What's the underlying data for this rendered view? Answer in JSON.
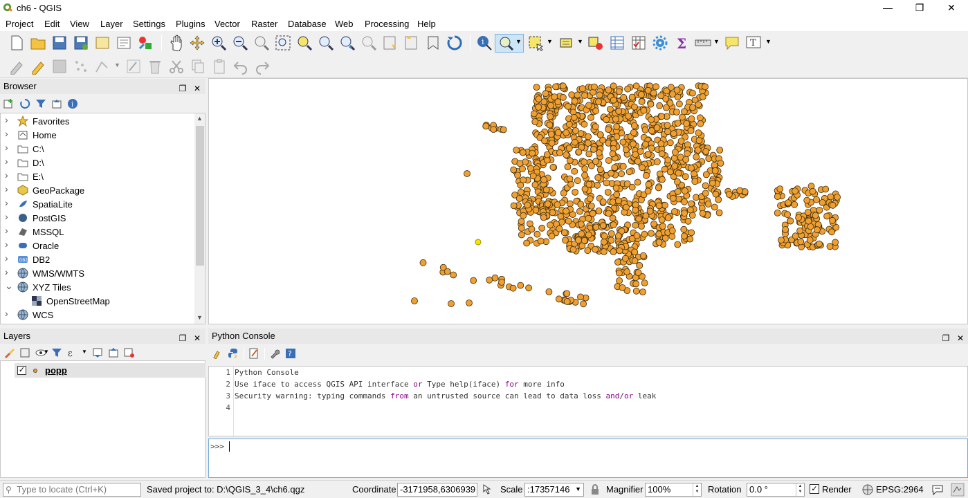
{
  "window": {
    "title": "ch6 - QGIS",
    "minimize": "—",
    "maximize": "❐",
    "close": "✕"
  },
  "menu": [
    "Project",
    "Edit",
    "View",
    "Layer",
    "Settings",
    "Plugins",
    "Vector",
    "Raster",
    "Database",
    "Web",
    "Processing",
    "Help"
  ],
  "browser": {
    "title": "Browser",
    "items": [
      {
        "label": "Favorites",
        "icon": "star-icon",
        "expand": false
      },
      {
        "label": "Home",
        "icon": "home-icon",
        "expand": true
      },
      {
        "label": "C:\\",
        "icon": "folder-icon",
        "expand": true
      },
      {
        "label": "D:\\",
        "icon": "folder-icon",
        "expand": true
      },
      {
        "label": "E:\\",
        "icon": "folder-icon",
        "expand": true
      },
      {
        "label": "GeoPackage",
        "icon": "geopackage-icon",
        "expand": true
      },
      {
        "label": "SpatiaLite",
        "icon": "spatialite-icon",
        "expand": false
      },
      {
        "label": "PostGIS",
        "icon": "postgis-icon",
        "expand": true
      },
      {
        "label": "MSSQL",
        "icon": "mssql-icon",
        "expand": true
      },
      {
        "label": "Oracle",
        "icon": "oracle-icon",
        "expand": true
      },
      {
        "label": "DB2",
        "icon": "db2-icon",
        "expand": true
      },
      {
        "label": "WMS/WMTS",
        "icon": "globe-icon",
        "expand": true
      },
      {
        "label": "XYZ Tiles",
        "icon": "globe-icon",
        "expand": "open"
      },
      {
        "label": "OpenStreetMap",
        "icon": "tiles-icon",
        "expand": "child"
      },
      {
        "label": "WCS",
        "icon": "globe-icon",
        "expand": false
      }
    ]
  },
  "layers": {
    "title": "Layers",
    "items": [
      {
        "label": "popp",
        "checked": true,
        "color": "#e8a040"
      }
    ]
  },
  "console": {
    "title": "Python Console",
    "lines": [
      {
        "no": "1",
        "text": "Python Console"
      },
      {
        "no": "2",
        "pre": "Use iface to access QGIS API interface ",
        "kw1": "or",
        "mid": " Type help(iface) ",
        "kw2": "for",
        "post": " more info"
      },
      {
        "no": "3",
        "pre": "Security warning: typing commands ",
        "kw1": "from",
        "mid": " an untrusted source can lead to data loss ",
        "kw2": "and",
        "post2": "/",
        "kw3": "or",
        "post": " leak"
      },
      {
        "no": "4",
        "text": ""
      }
    ],
    "prompt": ">>>"
  },
  "status": {
    "locate_placeholder": "Type to locate (Ctrl+K)",
    "message": "Saved project to: D:\\QGIS_3_4\\ch6.qgz",
    "coordinate_label": "Coordinate",
    "coordinate": "-3171958,6306939",
    "scale_label": "Scale",
    "scale": ":17357146",
    "magnifier_label": "Magnifier",
    "magnifier": "100%",
    "rotation_label": "Rotation",
    "rotation": "0.0 °",
    "render_label": "Render",
    "crs": "EPSG:2964"
  },
  "colors": {
    "point_fill": "#f0a030",
    "point_stroke": "#3a2a10",
    "selected_point": "#f5e600"
  }
}
